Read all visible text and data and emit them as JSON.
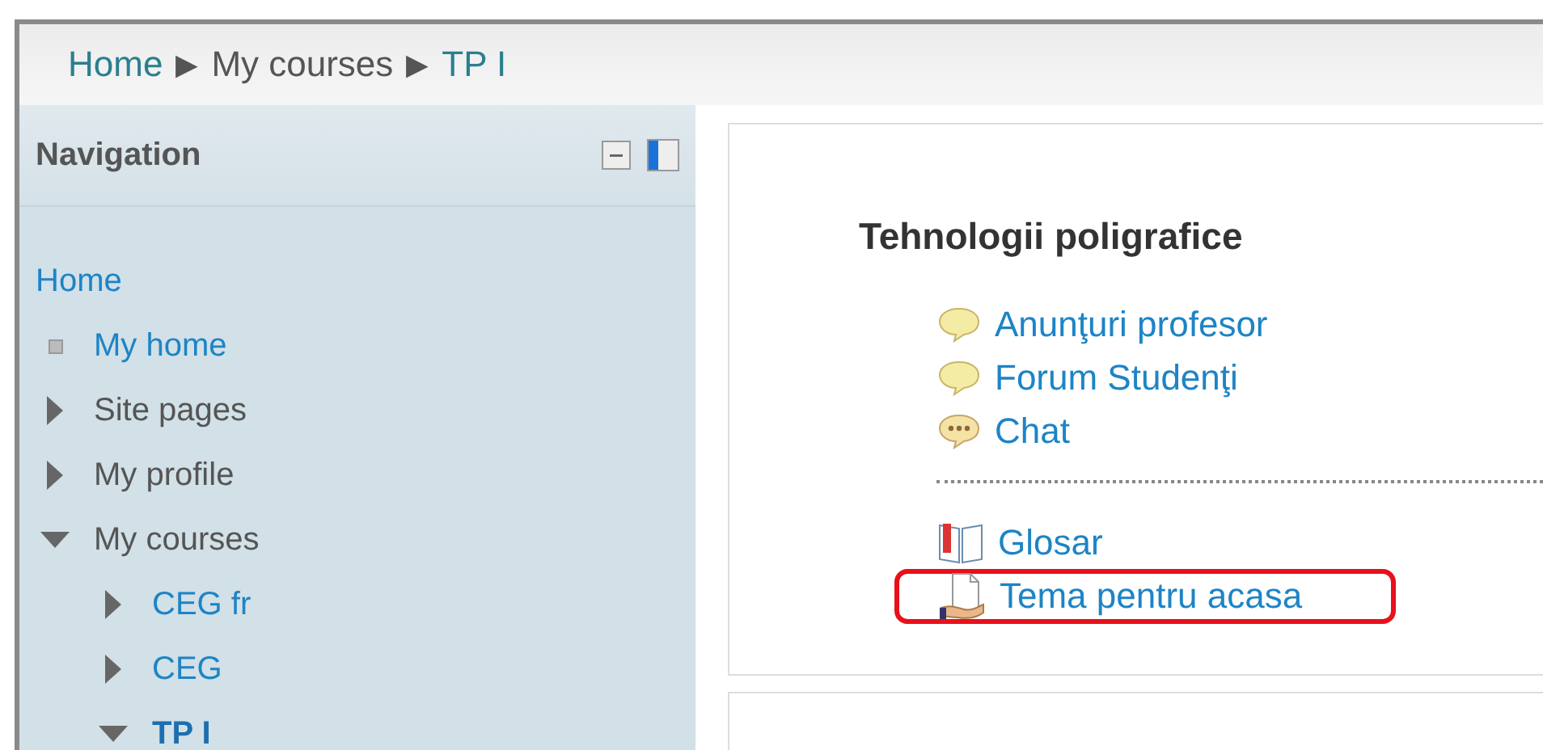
{
  "breadcrumb": [
    {
      "label": "Home",
      "link": true
    },
    {
      "label": "My courses",
      "link": false,
      "separator": "▶"
    },
    {
      "label": "TP I",
      "link": true,
      "separator": "▶"
    }
  ],
  "navigation": {
    "title": "Navigation",
    "items": [
      {
        "label": "Home",
        "kind": "root",
        "link": true,
        "current": false,
        "children": [
          {
            "label": "My home",
            "kind": "leaf",
            "link": true,
            "current": false
          },
          {
            "label": "Site pages",
            "kind": "branch",
            "link": false,
            "expanded": false,
            "current": false
          },
          {
            "label": "My profile",
            "kind": "branch",
            "link": false,
            "expanded": false,
            "current": false
          },
          {
            "label": "My courses",
            "kind": "branch",
            "link": false,
            "expanded": true,
            "current": false,
            "children": [
              {
                "label": "CEG fr",
                "kind": "branch",
                "link": true,
                "expanded": false,
                "current": false
              },
              {
                "label": "CEG",
                "kind": "branch",
                "link": true,
                "expanded": false,
                "current": false
              },
              {
                "label": "TP I",
                "kind": "branch",
                "link": true,
                "expanded": true,
                "current": true
              }
            ]
          }
        ]
      }
    ]
  },
  "course": {
    "title": "Tehnologii poligrafice",
    "groups": [
      [
        {
          "label": "Anunţuri profesor",
          "kind": "forum",
          "highlighted": false
        },
        {
          "label": "Forum Studenţi",
          "kind": "forum",
          "highlighted": false
        },
        {
          "label": "Chat",
          "kind": "chat",
          "highlighted": false
        }
      ],
      [
        {
          "label": "Glosar",
          "kind": "glossary",
          "highlighted": false
        },
        {
          "label": "Tema pentru acasa",
          "kind": "assignment",
          "highlighted": true
        }
      ]
    ]
  }
}
